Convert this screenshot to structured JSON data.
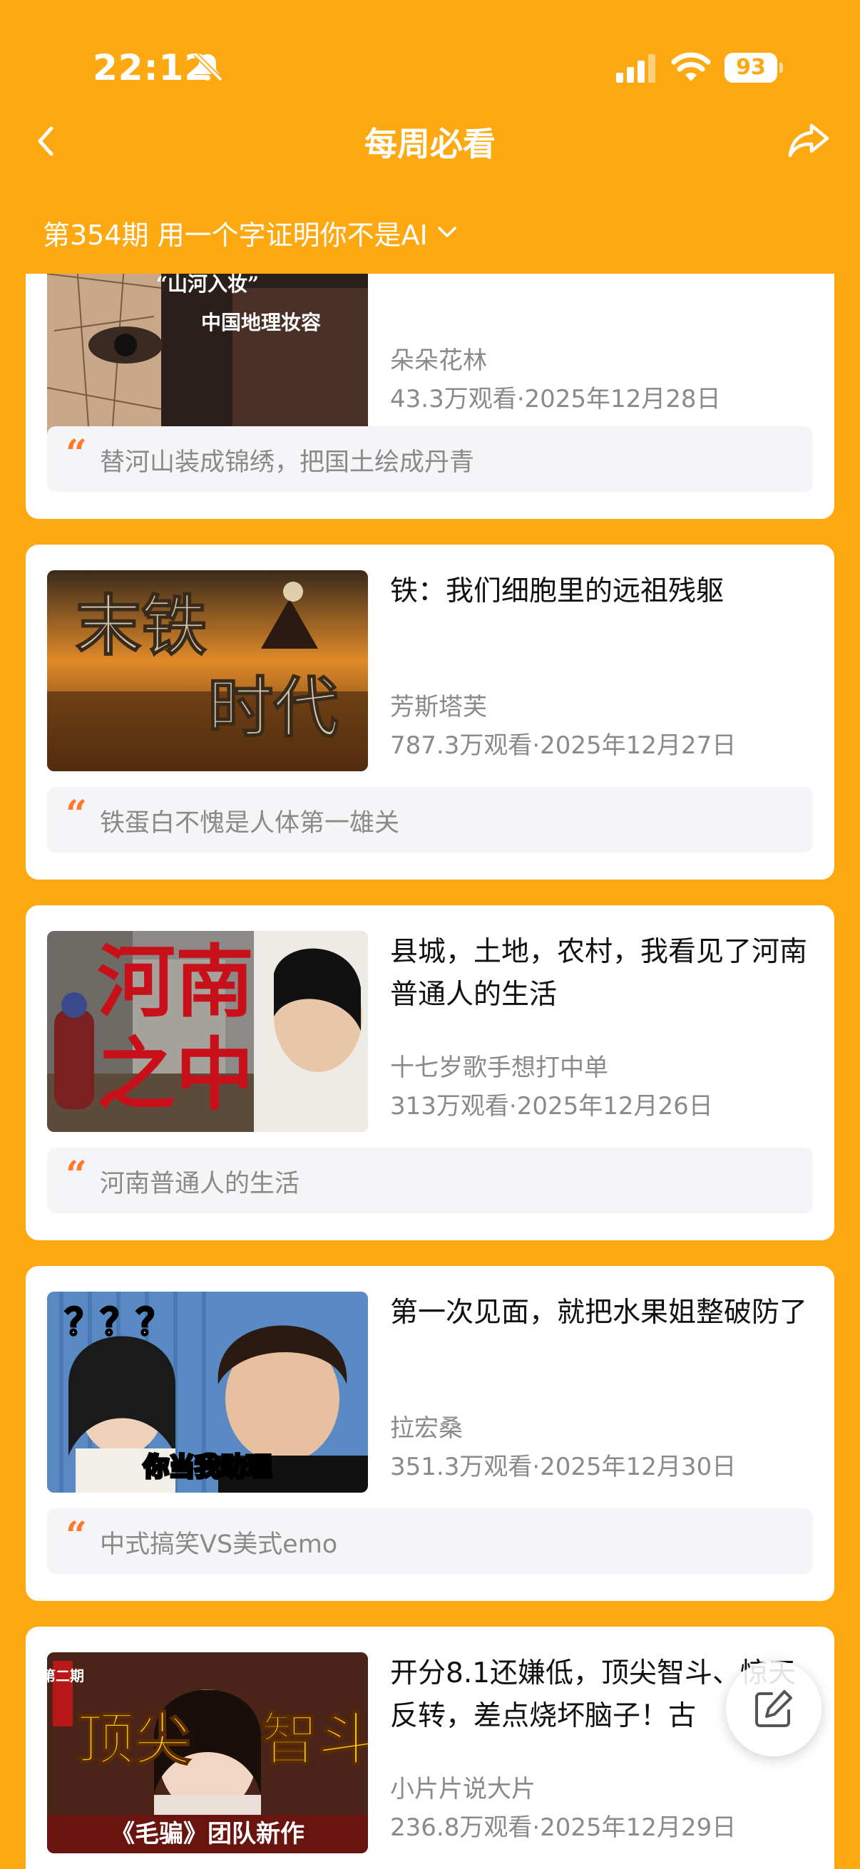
{
  "status_bar": {
    "time": "22:12",
    "battery": "93"
  },
  "nav": {
    "title": "每周必看"
  },
  "issue_selector": {
    "label": "第354期 用一个字证明你不是AI"
  },
  "cards": [
    {
      "title": "",
      "thumb_text": [
        "“山河入妆”",
        "中国地理妆容"
      ],
      "author": "朵朵花林",
      "meta": "43.3万观看·2025年12月28日",
      "quote": "替河山装成锦绣，把国土绘成丹青"
    },
    {
      "title": "铁：我们细胞里的远祖残躯",
      "thumb_text": [
        "末铁",
        "时代"
      ],
      "author": "芳斯塔芙",
      "meta": "787.3万观看·2025年12月27日",
      "quote": "铁蛋白不愧是人体第一雄关"
    },
    {
      "title": "县城，土地，农村，我看见了河南普通人的生活",
      "thumb_text": [
        "河南",
        "之中"
      ],
      "author": "十七岁歌手想打中单",
      "meta": "313万观看·2025年12月26日",
      "quote": "河南普通人的生活"
    },
    {
      "title": "第一次见面，就把水果姐整破防了",
      "thumb_text": [
        "？？？",
        "你当我助理"
      ],
      "author": "拉宏桑",
      "meta": "351.3万观看·2025年12月30日",
      "quote": "中式搞笑VS美式emo"
    },
    {
      "title": "开分8.1还嫌低，顶尖智斗、惊天反转，差点烧坏脑子！古",
      "thumb_text": [
        "顶尖",
        "智斗",
        "《毛骗》团队新作",
        "第二期"
      ],
      "author": "小片片说大片",
      "meta": "236.8万观看·2025年12月29日",
      "quote": ""
    }
  ],
  "colors": {
    "brand": "#FFA912",
    "quote_mark": "#FF7A2A"
  }
}
